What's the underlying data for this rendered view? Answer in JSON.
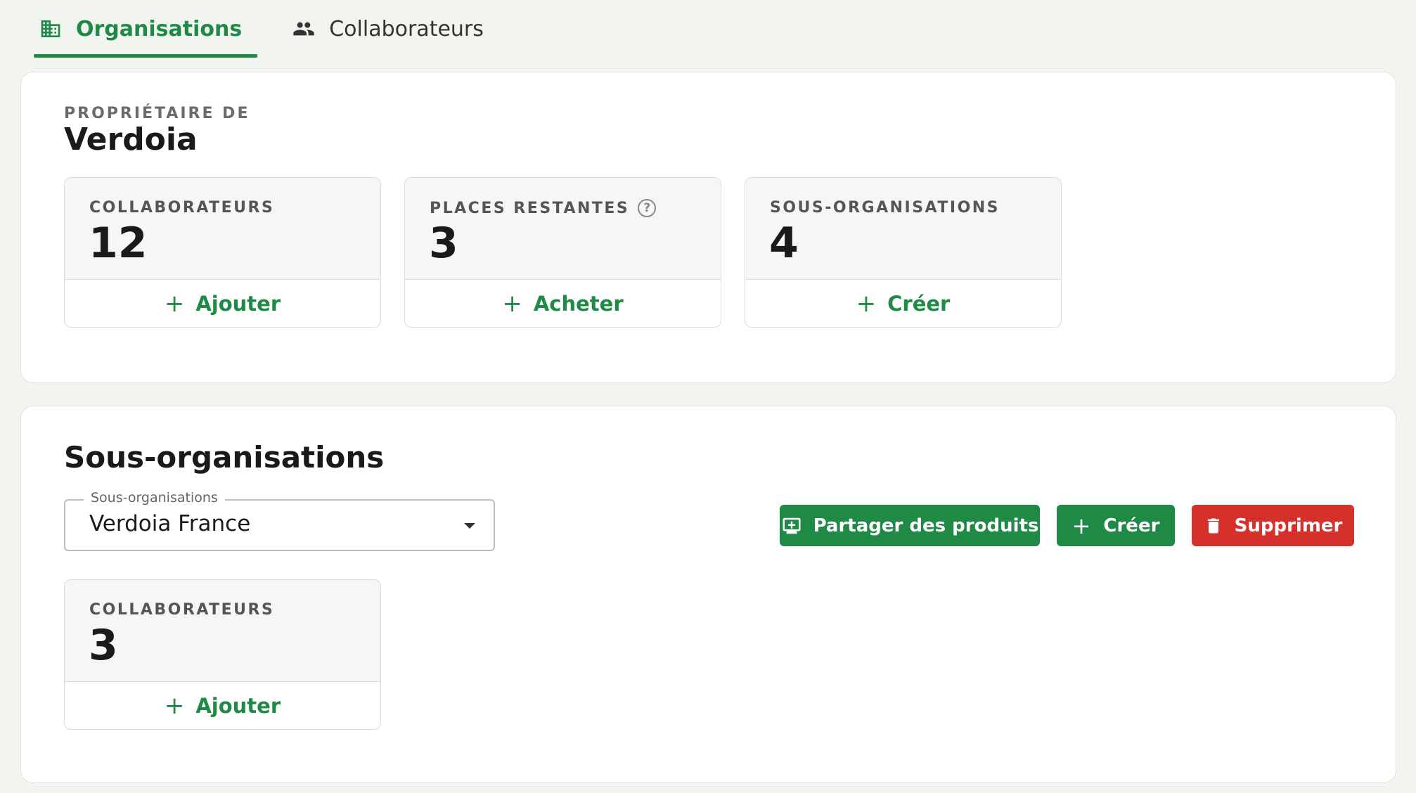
{
  "tabs": [
    {
      "label": "Organisations",
      "icon": "building-icon",
      "active": true
    },
    {
      "label": "Collaborateurs",
      "icon": "people-icon",
      "active": false
    }
  ],
  "owner": {
    "eyebrow": "PROPRIÉTAIRE DE",
    "name": "Verdoia",
    "stats": [
      {
        "label": "COLLABORATEURS",
        "value": "12",
        "action": "Ajouter"
      },
      {
        "label": "PLACES RESTANTES",
        "value": "3",
        "action": "Acheter",
        "help": "?"
      },
      {
        "label": "SOUS-ORGANISATIONS",
        "value": "4",
        "action": "Créer"
      }
    ]
  },
  "suborgs": {
    "title": "Sous-organisations",
    "select": {
      "legend": "Sous-organisations",
      "value": "Verdoia France"
    },
    "buttons": {
      "share": "Partager des produits",
      "create": "Créer",
      "delete": "Supprimer"
    },
    "stats": [
      {
        "label": "COLLABORATEURS",
        "value": "3",
        "action": "Ajouter"
      }
    ]
  },
  "colors": {
    "accent": "#1e8a45",
    "danger": "#d6302b",
    "background": "#f2f4ef"
  }
}
